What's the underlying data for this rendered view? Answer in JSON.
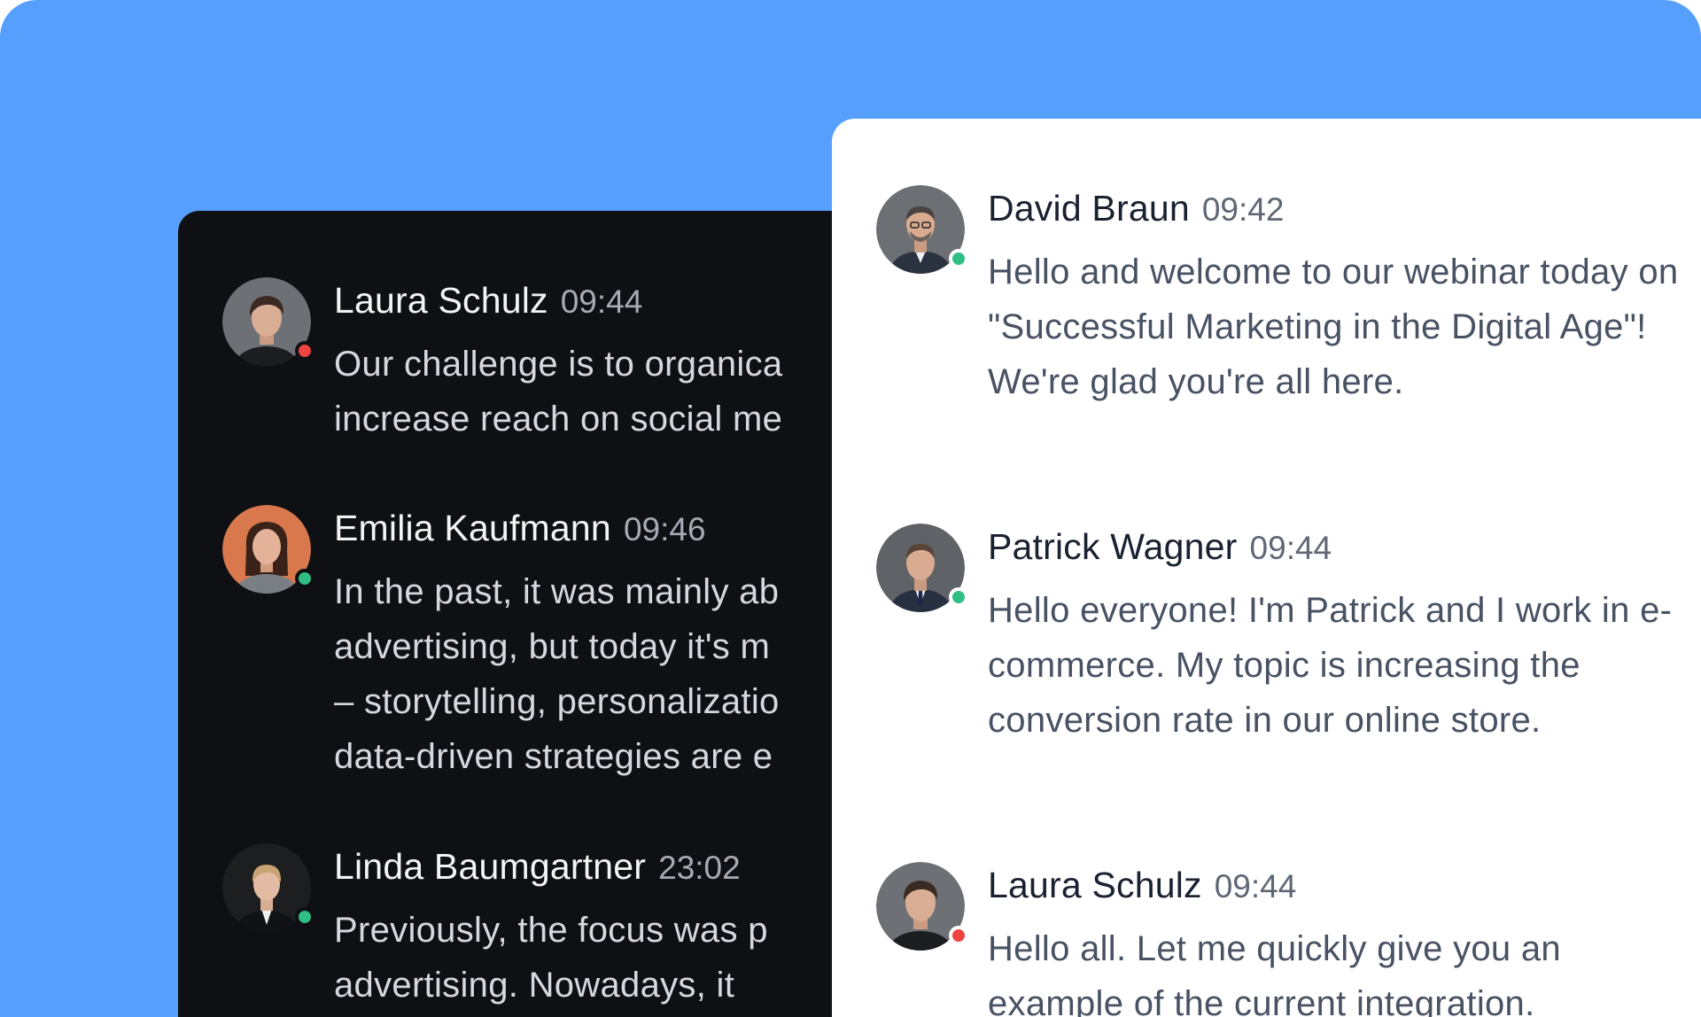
{
  "colors": {
    "backdrop": "#569ffd",
    "dark_panel": "#0f1013",
    "light_panel": "#ffffff",
    "status_online": "#2fbf85",
    "status_busy": "#ef4444"
  },
  "dark_chat": {
    "messages": [
      {
        "name": "Laura Schulz",
        "time": "09:44",
        "status": "busy",
        "lines": [
          "Our challenge is to organica",
          "increase reach on social me"
        ]
      },
      {
        "name": "Emilia Kaufmann",
        "time": "09:46",
        "status": "online",
        "lines": [
          "In the past, it was mainly ab",
          "advertising, but today it's m",
          "– storytelling, personalizatio",
          "data-driven strategies are e"
        ]
      },
      {
        "name": "Linda Baumgartner",
        "time": "23:02",
        "status": "online",
        "lines": [
          "Previously, the focus was p",
          "advertising. Nowadays, it"
        ]
      }
    ]
  },
  "light_chat": {
    "messages": [
      {
        "name": "David Braun",
        "time": "09:42",
        "status": "online",
        "text": "Hello and welcome to our webinar today on \"Successful Marketing in the Digital Age\"! We're glad you're all here."
      },
      {
        "name": "Patrick Wagner",
        "time": "09:44",
        "status": "online",
        "text": "Hello everyone! I'm Patrick and I work in e-commerce. My topic is increasing the conversion rate in our online store."
      },
      {
        "name": "Laura Schulz",
        "time": "09:44",
        "status": "busy",
        "text": "Hello all. Let me quickly give you an example of the current integration."
      }
    ]
  }
}
